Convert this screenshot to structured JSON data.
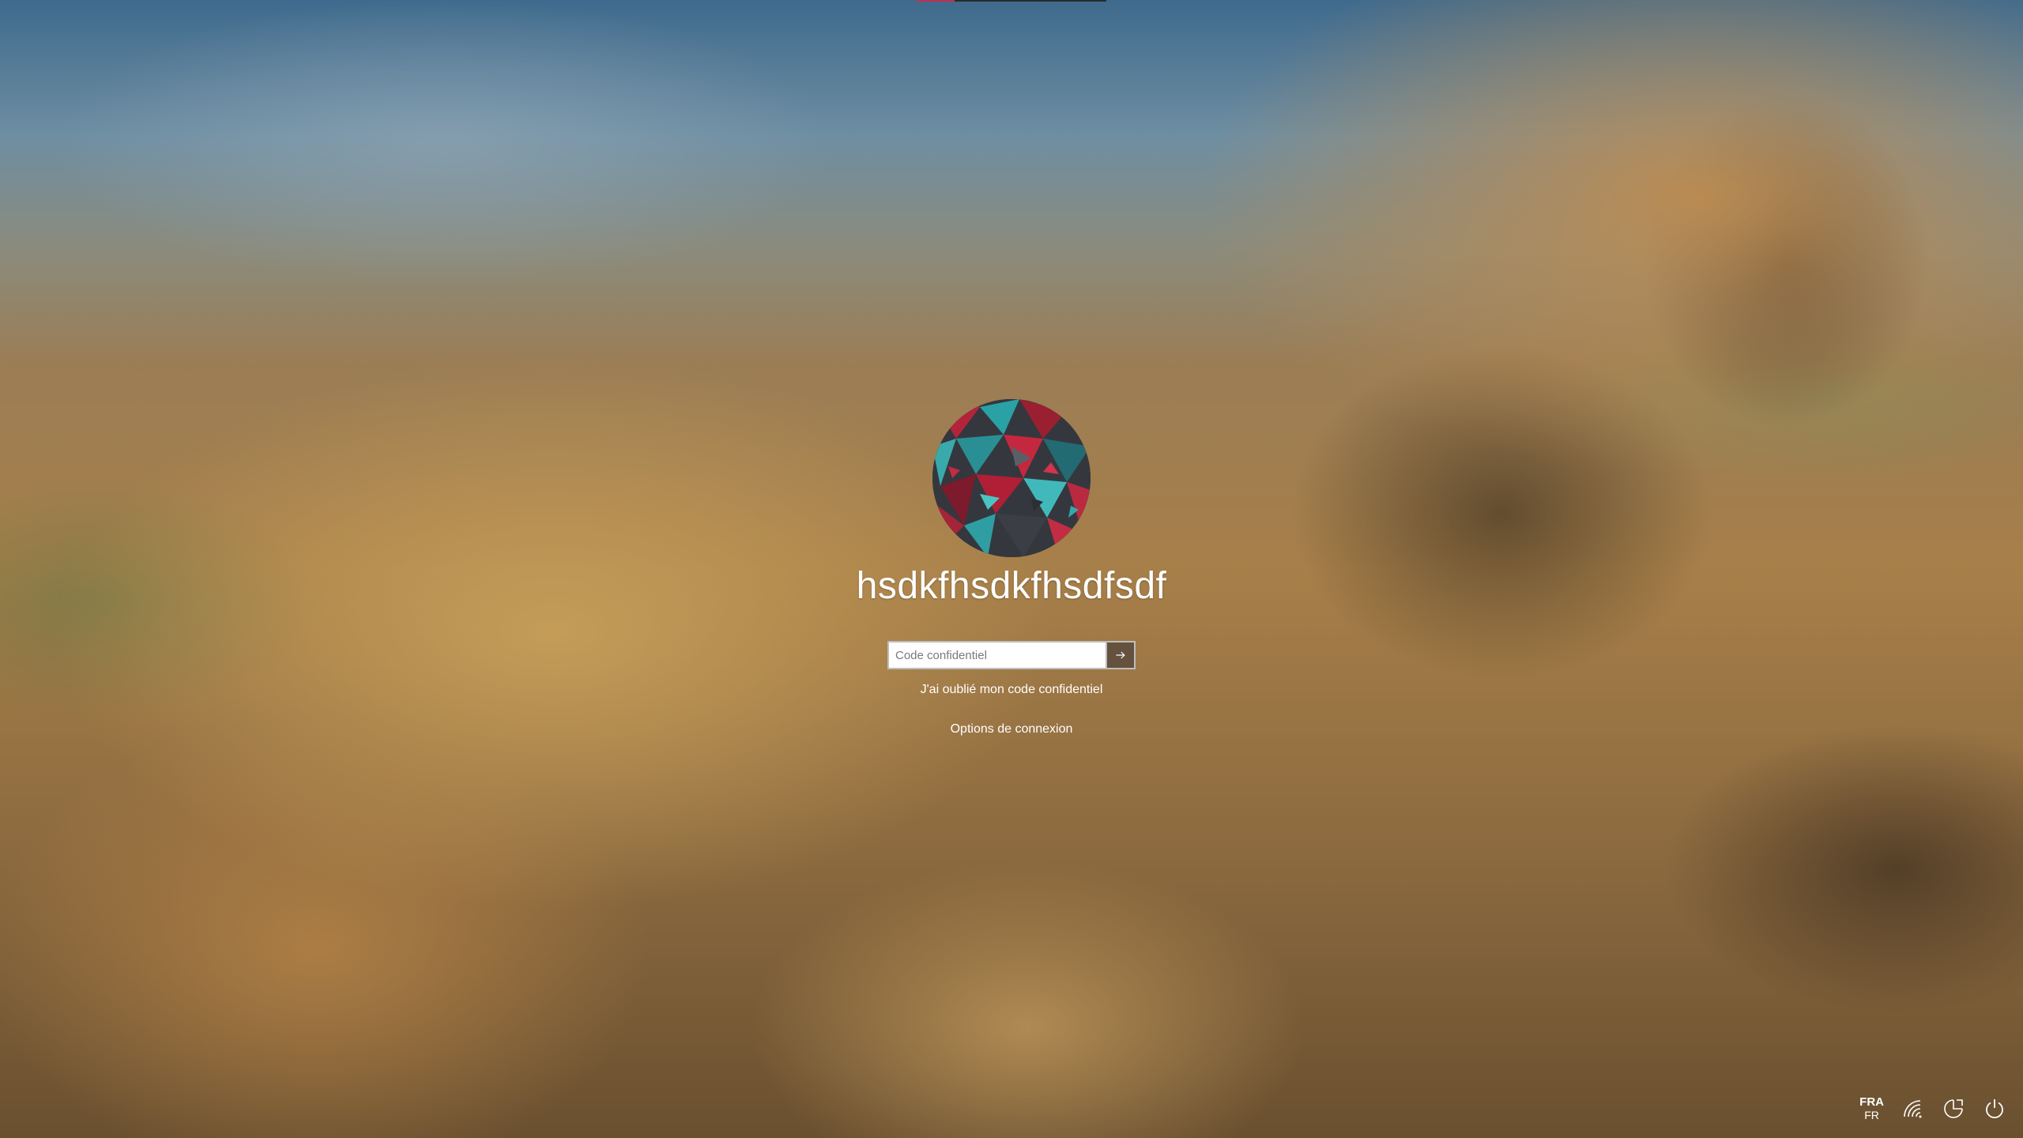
{
  "login": {
    "username": "hsdkfhsdkfhsdfsdf",
    "pin_placeholder": "Code confidentiel",
    "pin_value": "",
    "forgot_pin_label": "J'ai oublié mon code confidentiel",
    "signin_options_label": "Options de connexion"
  },
  "tray": {
    "language_code": "FRA",
    "language_sub": "FR",
    "icons": [
      "network-icon",
      "ease-of-access-icon",
      "power-icon"
    ]
  },
  "colors": {
    "accent_top": "#c03050",
    "text": "#ffffff"
  }
}
